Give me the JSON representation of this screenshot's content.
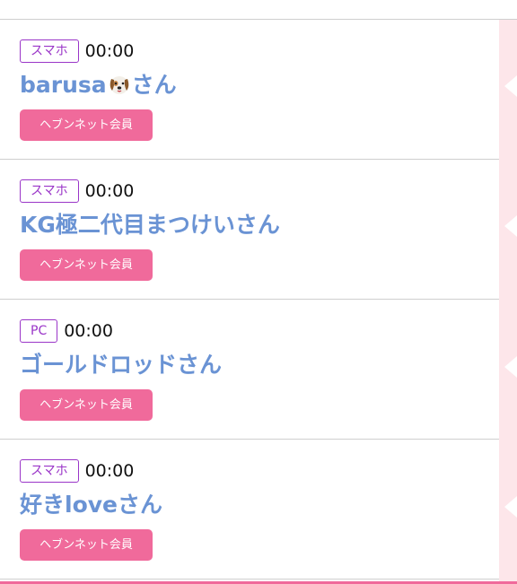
{
  "members": [
    {
      "device": "スマホ",
      "time": "00:00",
      "name": "barusa",
      "name_icon": "dog-face-icon",
      "suffix": "さん",
      "button": "ヘブンネット会員"
    },
    {
      "device": "スマホ",
      "time": "00:00",
      "name": "KG極二代目まつけい",
      "suffix": "さん",
      "button": "ヘブンネット会員"
    },
    {
      "device": "PC",
      "time": "00:00",
      "name": "ゴールドロッド",
      "suffix": "さん",
      "button": "ヘブンネット会員"
    },
    {
      "device": "スマホ",
      "time": "00:00",
      "name": "好きlove",
      "suffix": "さん",
      "button": "ヘブンネット会員"
    }
  ],
  "colors": {
    "badge_border": "#9a35c8",
    "name_text": "#6a93d4",
    "button_bg": "#f06a9b",
    "rail_bg": "#fde6ea",
    "divider": "#cfcfcf"
  }
}
